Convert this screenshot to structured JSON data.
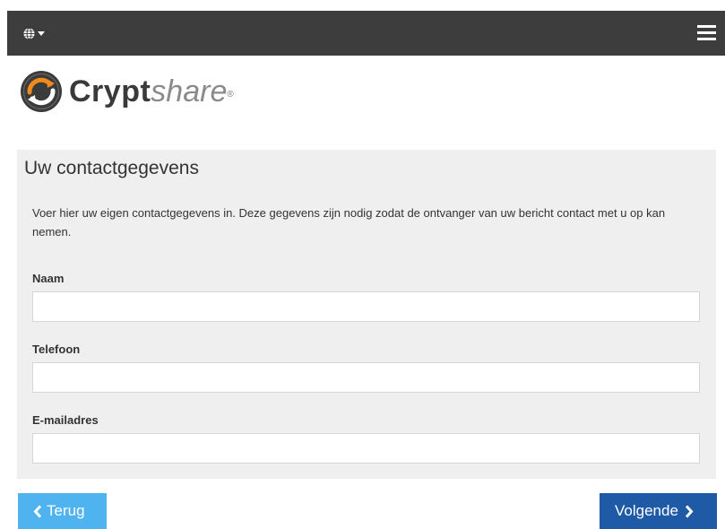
{
  "header": {
    "language_icon": "globe-icon",
    "menu_icon": "hamburger-menu-icon"
  },
  "logo": {
    "bold": "Crypt",
    "light": "share",
    "registered": "®"
  },
  "form": {
    "title": "Uw contactgegevens",
    "description": "Voer hier uw eigen contactgegevens in. Deze gegevens zijn nodig zodat de ontvanger van uw bericht contact met u op kan nemen.",
    "fields": [
      {
        "label": "Naam",
        "value": "",
        "placeholder": ""
      },
      {
        "label": "Telefoon",
        "value": "",
        "placeholder": ""
      },
      {
        "label": "E-mailadres",
        "value": "",
        "placeholder": ""
      }
    ]
  },
  "nav": {
    "back_label": "Terug",
    "next_label": "Volgende"
  },
  "colors": {
    "topbar": "#3d3d3d",
    "panel": "#efefef",
    "back_button": "#4fb3f0",
    "next_button": "#1f5aa6",
    "logo_orange": "#f08a1c"
  }
}
